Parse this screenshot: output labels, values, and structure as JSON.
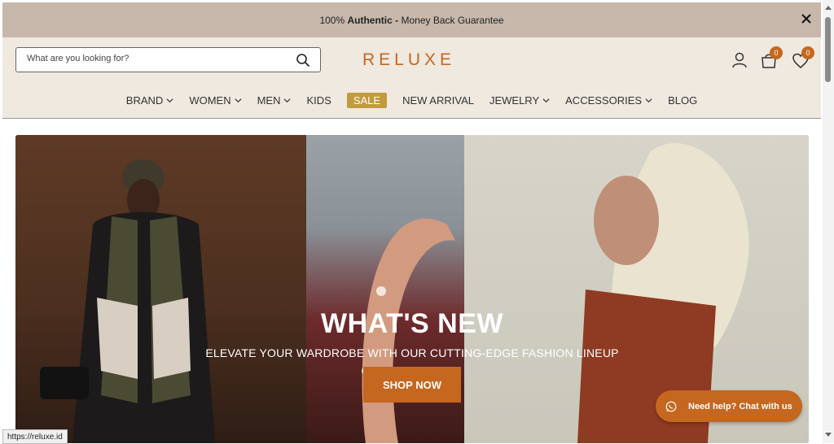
{
  "announcement": {
    "prefix": "100% ",
    "bold": "Authentic -",
    "suffix": " Money Back Guarantee"
  },
  "search": {
    "placeholder": "What are you looking for?"
  },
  "brand": {
    "logo": "RELUXE"
  },
  "header": {
    "cart_count": "0",
    "wishlist_count": "0"
  },
  "nav": {
    "items": [
      {
        "label": "BRAND",
        "dropdown": true
      },
      {
        "label": "WOMEN",
        "dropdown": true
      },
      {
        "label": "MEN",
        "dropdown": true
      },
      {
        "label": "KIDS",
        "dropdown": false
      },
      {
        "label": "SALE",
        "dropdown": false,
        "highlight": true
      },
      {
        "label": "NEW ARRIVAL",
        "dropdown": false
      },
      {
        "label": "JEWELRY",
        "dropdown": true
      },
      {
        "label": "ACCESSORIES",
        "dropdown": true
      },
      {
        "label": "BLOG",
        "dropdown": false
      }
    ]
  },
  "hero": {
    "title": "WHAT'S NEW",
    "subtitle": "ELEVATE YOUR WARDROBE WITH OUR CUTTING-EDGE FASHION LINEUP",
    "cta": "SHOP NOW"
  },
  "chat": {
    "label": "Need help? Chat with us"
  },
  "status_bar": {
    "url": "https://reluxe.id"
  },
  "colors": {
    "accent": "#c5671f",
    "sale": "#c29a3f",
    "topbar": "#c7b8ab",
    "header_bg": "#efe9df"
  },
  "icons": [
    "close-icon",
    "search-icon",
    "user-icon",
    "cart-icon",
    "heart-icon",
    "chevron-down-icon",
    "whatsapp-icon"
  ]
}
